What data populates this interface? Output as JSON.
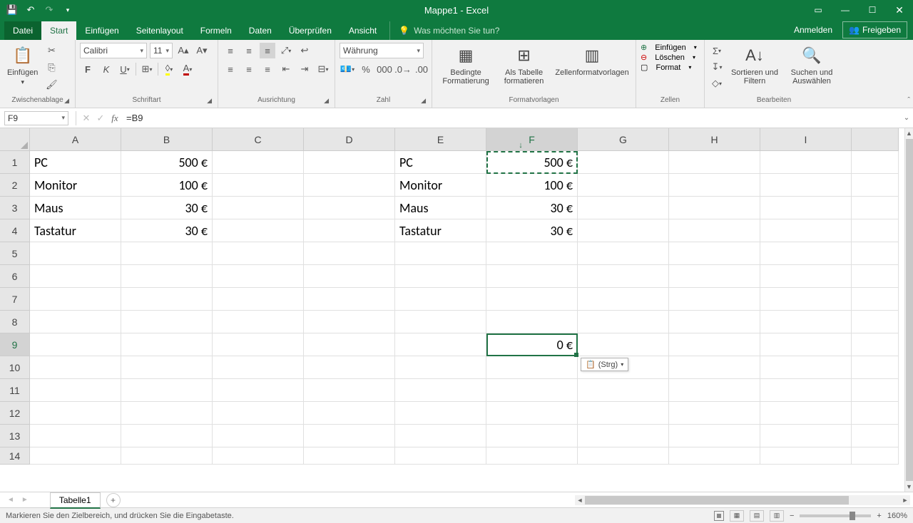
{
  "app": {
    "title": "Mappe1 - Excel"
  },
  "tabs": {
    "file": "Datei",
    "items": [
      "Start",
      "Einfügen",
      "Seitenlayout",
      "Formeln",
      "Daten",
      "Überprüfen",
      "Ansicht"
    ],
    "active": 0,
    "tell_me": "Was möchten Sie tun?",
    "sign_in": "Anmelden",
    "share": "Freigeben"
  },
  "ribbon": {
    "clipboard": {
      "paste": "Einfügen",
      "label": "Zwischenablage"
    },
    "font": {
      "name": "Calibri",
      "size": "11",
      "label": "Schriftart"
    },
    "align": {
      "label": "Ausrichtung"
    },
    "number": {
      "format": "Währung",
      "label": "Zahl"
    },
    "styles": {
      "cond": "Bedingte Formatierung",
      "table": "Als Tabelle formatieren",
      "cell": "Zellenformatvorlagen",
      "label": "Formatvorlagen"
    },
    "cells": {
      "insert": "Einfügen",
      "delete": "Löschen",
      "format": "Format",
      "label": "Zellen"
    },
    "editing": {
      "sort": "Sortieren und Filtern",
      "find": "Suchen und Auswählen",
      "label": "Bearbeiten"
    }
  },
  "formula_bar": {
    "name_box": "F9",
    "formula": "=B9"
  },
  "columns": [
    "A",
    "B",
    "C",
    "D",
    "E",
    "F",
    "G",
    "H",
    "I"
  ],
  "rows": {
    "count": 14,
    "last_partial": true
  },
  "data": {
    "A1": "PC",
    "B1": "500 €",
    "E1": "PC",
    "F1": "500 €",
    "A2": "Monitor",
    "B2": "100 €",
    "E2": "Monitor",
    "F2": "100 €",
    "A3": "Maus",
    "B3": "30 €",
    "E3": "Maus",
    "F3": "30 €",
    "A4": "Tastatur",
    "B4": "30 €",
    "E4": "Tastatur",
    "F4": "30 €",
    "F9": "0 €"
  },
  "active_cell": "F9",
  "copy_range": "F1",
  "paste_options": "(Strg)",
  "sheet": {
    "active": "Tabelle1"
  },
  "status": {
    "msg": "Markieren Sie den Zielbereich, und drücken Sie die Eingabetaste.",
    "zoom": "160%"
  }
}
